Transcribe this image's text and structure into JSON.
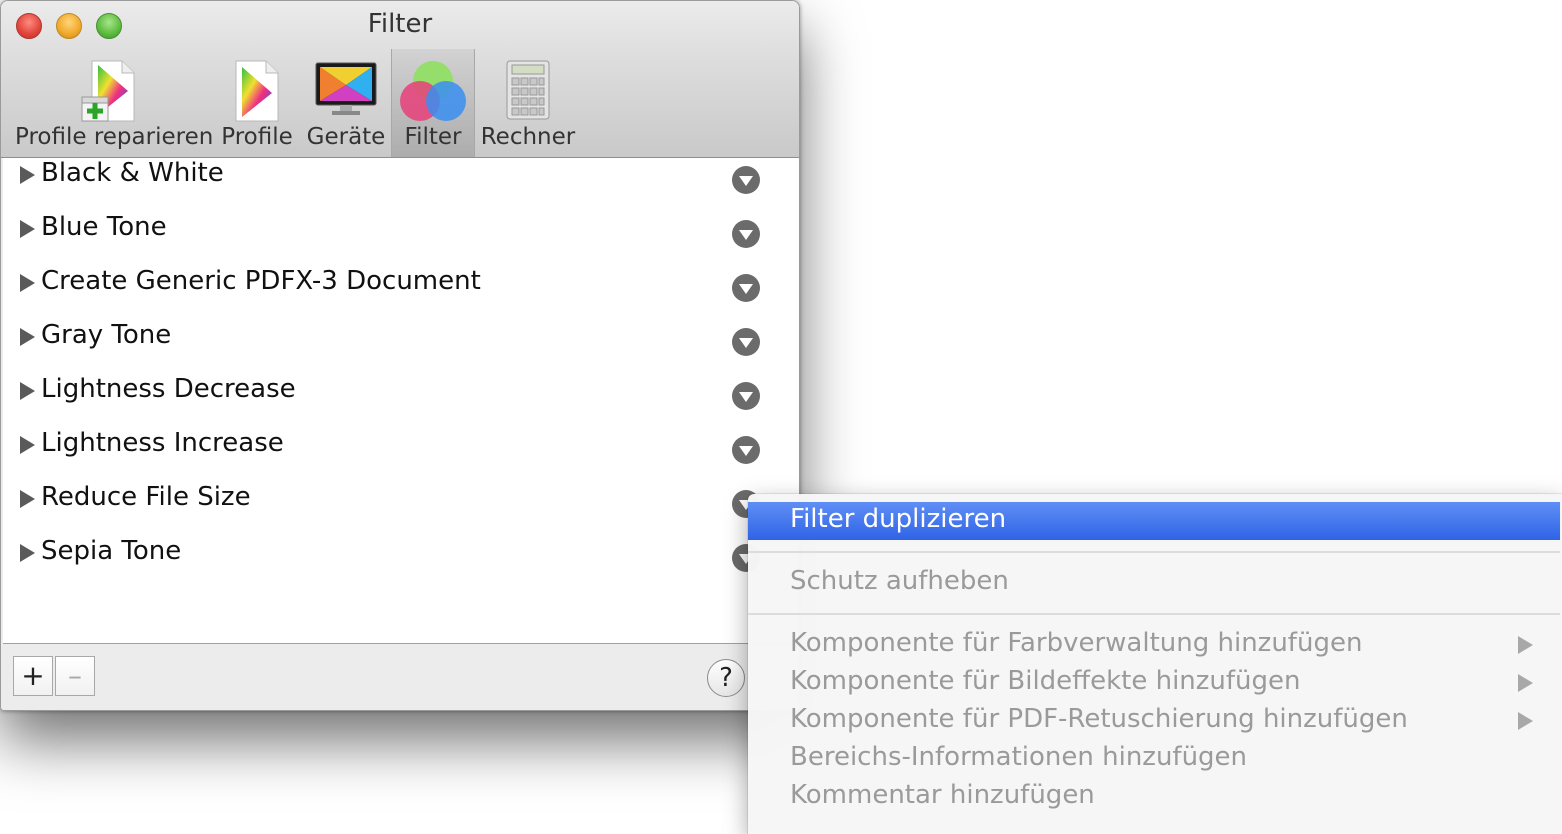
{
  "window": {
    "title": "Filter",
    "toolbar": [
      {
        "label": "Profile reparieren",
        "icon": "repair-profile-icon",
        "selected": false
      },
      {
        "label": "Profile",
        "icon": "profile-icon",
        "selected": false
      },
      {
        "label": "Geräte",
        "icon": "display-icon",
        "selected": false
      },
      {
        "label": "Filter",
        "icon": "filter-icon",
        "selected": true
      },
      {
        "label": "Rechner",
        "icon": "calculator-icon",
        "selected": false
      }
    ]
  },
  "filters": [
    {
      "label": "Black & White"
    },
    {
      "label": "Blue Tone"
    },
    {
      "label": "Create Generic PDFX-3 Document"
    },
    {
      "label": "Gray Tone"
    },
    {
      "label": "Lightness Decrease"
    },
    {
      "label": "Lightness Increase"
    },
    {
      "label": "Reduce File Size"
    },
    {
      "label": "Sepia Tone"
    }
  ],
  "bottombar": {
    "add_label": "+",
    "remove_label": "–",
    "help_label": "?"
  },
  "context_menu": {
    "items": [
      {
        "label": "Filter duplizieren",
        "active": true,
        "submenu": false
      },
      {
        "label": "Schutz aufheben",
        "active": false,
        "submenu": false
      },
      {
        "label": "Komponente für Farbverwaltung hinzufügen",
        "active": false,
        "submenu": true
      },
      {
        "label": "Komponente für Bildeffekte hinzufügen",
        "active": false,
        "submenu": true
      },
      {
        "label": "Komponente für PDF-Retuschierung hinzufügen",
        "active": false,
        "submenu": true
      },
      {
        "label": "Bereichs-Informationen hinzufügen",
        "active": false,
        "submenu": false
      },
      {
        "label": "Kommentar hinzufügen",
        "active": false,
        "submenu": false
      }
    ]
  },
  "colors": {
    "menu_highlight": "#3d6ee9",
    "disabled_text": "#9a9a9a"
  }
}
